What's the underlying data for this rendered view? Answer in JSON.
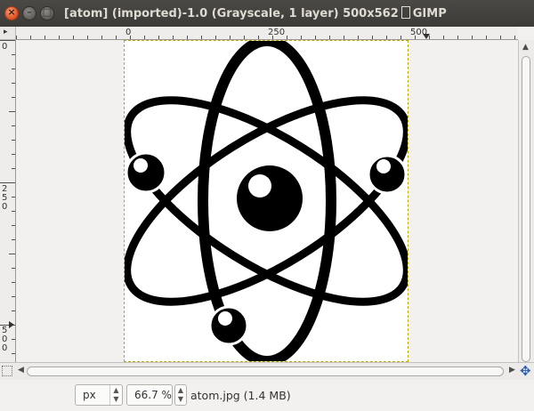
{
  "window": {
    "title_part1": "[atom] (imported)-1.0 (Grayscale, 1 layer) 500x562",
    "title_part2": "GIMP",
    "close_glyph": "×",
    "minimize_glyph": "–",
    "maximize_glyph": "□"
  },
  "rulers": {
    "corner_glyph": "▸",
    "horizontal_labels": [
      "0",
      "250",
      "500"
    ],
    "vertical_labels": [
      "0",
      "250",
      "500"
    ]
  },
  "image": {
    "alt": "atom symbol"
  },
  "statusbar": {
    "unit": "px",
    "zoom": "66.7 %",
    "file_info": "atom.jpg (1.4 MB)"
  },
  "icons": {
    "spinner_up": "▲",
    "spinner_down": "▼",
    "scroll_up": "▲",
    "scroll_left": "◀",
    "scroll_right": "▶",
    "navigate": "✥"
  },
  "colors": {
    "titlebar": "#3c3b37",
    "close_button": "#e2582b",
    "canvas_bg": "#f2f1f0",
    "image_bg": "#ffffff",
    "boundary": "#b8a800"
  }
}
